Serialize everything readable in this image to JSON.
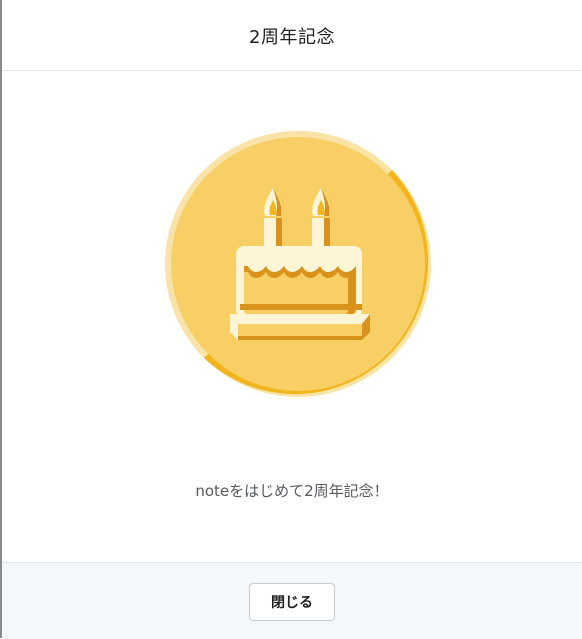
{
  "dialog": {
    "title": "2周年記念",
    "message": "noteをはじめて2周年記念！",
    "close_label": "閉じる"
  },
  "badge": {
    "icon": "birthday-cake-icon",
    "candles": 2,
    "progress": 0.5,
    "colors": {
      "face": "#f7cf65",
      "track": "#f9e3a6",
      "progress": "#f3b51d",
      "cake_light": "#fdf5d6",
      "cake_mid": "#f7cf65",
      "cake_dark": "#d9931c"
    }
  },
  "footer": {
    "background": "#f5f8fa"
  }
}
